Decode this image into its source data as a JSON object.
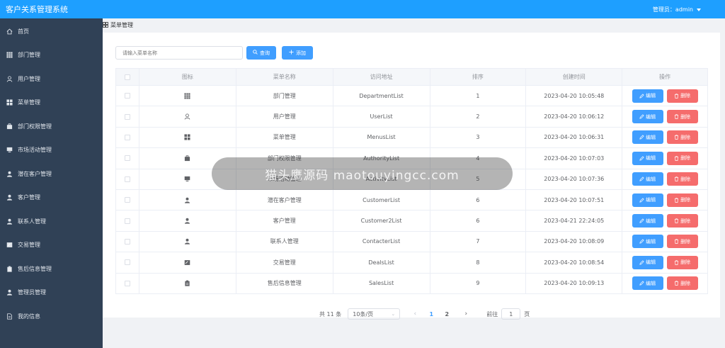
{
  "header": {
    "app_title": "客户关系管理系统",
    "admin_label": "管理员：admin"
  },
  "sidebar": {
    "items": [
      {
        "label": "首页",
        "icon": "home-icon"
      },
      {
        "label": "部门管理",
        "icon": "grid-icon"
      },
      {
        "label": "用户管理",
        "icon": "user-icon"
      },
      {
        "label": "菜单管理",
        "icon": "menu-icon"
      },
      {
        "label": "部门权限管理",
        "icon": "department-permission-icon"
      },
      {
        "label": "市场活动管理",
        "icon": "monitor-icon"
      },
      {
        "label": "潜在客户管理",
        "icon": "person-icon"
      },
      {
        "label": "客户管理",
        "icon": "person-icon"
      },
      {
        "label": "联系人管理",
        "icon": "person-icon"
      },
      {
        "label": "交易管理",
        "icon": "card-icon"
      },
      {
        "label": "售后信息管理",
        "icon": "clipboard-icon"
      },
      {
        "label": "管理员管理",
        "icon": "person-icon"
      },
      {
        "label": "我的信息",
        "icon": "document-icon"
      }
    ]
  },
  "breadcrumb": {
    "label": "菜单管理"
  },
  "toolbar": {
    "search_placeholder": "请输入菜单名称",
    "search_label": "查询",
    "add_label": "添加"
  },
  "table": {
    "headers": [
      "图标",
      "菜单名称",
      "访问地址",
      "排序",
      "创建时间",
      "操作"
    ],
    "edit_label": "编辑",
    "delete_label": "删除",
    "rows": [
      {
        "icon": "grid-icon",
        "name": "部门管理",
        "url": "DepartmentList",
        "order": "1",
        "created": "2023-04-20 10:05:48"
      },
      {
        "icon": "user-icon",
        "name": "用户管理",
        "url": "UserList",
        "order": "2",
        "created": "2023-04-20 10:06:12"
      },
      {
        "icon": "menu-icon",
        "name": "菜单管理",
        "url": "MenusList",
        "order": "3",
        "created": "2023-04-20 10:06:31"
      },
      {
        "icon": "department-permission-icon",
        "name": "部门权限管理",
        "url": "AuthorityList",
        "order": "4",
        "created": "2023-04-20 10:07:03"
      },
      {
        "icon": "monitor-icon",
        "name": "市场活动管理",
        "url": "ActivityList",
        "order": "5",
        "created": "2023-04-20 10:07:36"
      },
      {
        "icon": "person-icon",
        "name": "潜在客户管理",
        "url": "CustomerList",
        "order": "6",
        "created": "2023-04-20 10:07:51"
      },
      {
        "icon": "person-icon",
        "name": "客户管理",
        "url": "Customer2List",
        "order": "6",
        "created": "2023-04-21 22:24:05"
      },
      {
        "icon": "person-icon",
        "name": "联系人管理",
        "url": "ContacterList",
        "order": "7",
        "created": "2023-04-20 10:08:09"
      },
      {
        "icon": "card-icon",
        "name": "交易管理",
        "url": "DealsList",
        "order": "8",
        "created": "2023-04-20 10:08:54"
      },
      {
        "icon": "clipboard-icon",
        "name": "售后信息管理",
        "url": "SalesList",
        "order": "9",
        "created": "2023-04-20 10:09:13"
      }
    ]
  },
  "pagination": {
    "total_label": "共 11 条",
    "page_size": "10条/页",
    "pages": [
      "1",
      "2"
    ],
    "current_page": "1",
    "goto_label": "前往",
    "goto_value": "1",
    "page_unit": "页"
  },
  "watermark": {
    "text": "猫头鹰源码 maotouyingcc.com"
  },
  "colors": {
    "topbar": "#1e9fff",
    "sidebar": "#304156",
    "primary": "#409eff",
    "danger": "#f56c6c"
  }
}
